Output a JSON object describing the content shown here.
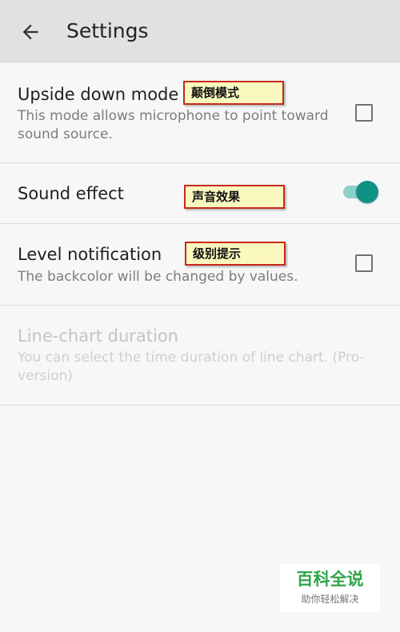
{
  "app_bar": {
    "title": "Settings",
    "back_icon": "arrow-left-icon"
  },
  "preferences": [
    {
      "title": "Upside down mode",
      "summary": "This mode allows microphone to point toward sound source.",
      "control": "checkbox",
      "checked": false,
      "enabled": true,
      "annotation": "颠倒模式"
    },
    {
      "title": "Sound effect",
      "summary": "",
      "control": "switch",
      "checked": true,
      "enabled": true,
      "annotation": "声音效果"
    },
    {
      "title": "Level notification",
      "summary": "The backcolor will be changed by values.",
      "control": "checkbox",
      "checked": false,
      "enabled": true,
      "annotation": "级别提示"
    },
    {
      "title": "Line-chart duration",
      "summary": "You can select the time duration of line chart. (Pro-version)",
      "control": "none",
      "enabled": false
    }
  ],
  "watermark": {
    "title": "百科全说",
    "subtitle": "助你轻松解决"
  },
  "colors": {
    "app_bar_bg": "#e1e1e1",
    "page_bg": "#f7f7f7",
    "switch_thumb": "#0f9183",
    "switch_track": "#8bd0c7",
    "annotation_bg": "#fbf8bf",
    "annotation_border": "#c8281a",
    "watermark_text": "#2ea54b"
  }
}
